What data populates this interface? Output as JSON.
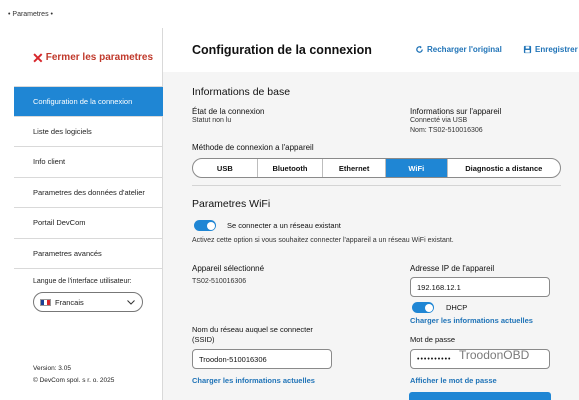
{
  "window": {
    "title": "• Parametres •"
  },
  "sidebar": {
    "close_label": "Fermer les parametres",
    "items": [
      {
        "label": "Configuration de la connexion",
        "active": true
      },
      {
        "label": "Liste des logiciels"
      },
      {
        "label": "Info client"
      },
      {
        "label": "Parametres des données d'atelier"
      },
      {
        "label": "Portail DevCom"
      },
      {
        "label": "Parametres avancés"
      }
    ],
    "language": {
      "label": "Langue de l'interface utilisateur:",
      "value": "Francais"
    },
    "version": "Version: 3.05",
    "copyright": "© DevCom spol. s r. o. 2025"
  },
  "header": {
    "title": "Configuration de la connexion",
    "reload_label": "Recharger l'original",
    "save_label": "Enregistrer"
  },
  "basic_info": {
    "title": "Informations de base",
    "connection_state_label": "État de la connexion",
    "connection_state_value": "Statut non lu",
    "device_info_label": "Informations sur l'appareil",
    "device_connected": "Connecté via USB",
    "device_name": "Nom: TS02-510016306"
  },
  "method": {
    "label": "Méthode de connexion a l'appareil",
    "options": [
      "USB",
      "Bluetooth",
      "Ethernet",
      "WiFi",
      "Diagnostic a distance"
    ],
    "selected": "WiFi"
  },
  "wifi": {
    "title": "Parametres WiFi",
    "connect_existing_label": "Se connecter a un réseau existant",
    "connect_existing_on": true,
    "description": "Activez cette option si vous souhaitez connecter l'appareil a un réseau WiFi existant.",
    "selected_device_label": "Appareil sélectionné",
    "selected_device_value": "TS02-510016306",
    "ip_label": "Adresse IP de l'appareil",
    "ip_value": "192.168.12.1",
    "dhcp_label": "DHCP",
    "dhcp_on": true,
    "load_current_ip": "Charger les informations actuelles",
    "ssid_label_line1": "Nom du réseau auquel se connecter",
    "ssid_label_line2": "(SSID)",
    "ssid_value": "Troodon-510016306",
    "load_current_ssid": "Charger les informations actuelles",
    "password_label": "Mot de passe",
    "password_value": "••••••••••",
    "password_overlay": "TroodonOBD",
    "show_password": "Afficher le mot de passe"
  },
  "colors": {
    "accent": "#1f86d4",
    "close_red": "#d7262b",
    "link": "#1f73b7"
  },
  "icons": {
    "close": "x-icon",
    "reload": "reload-icon",
    "save": "save-icon",
    "chevron": "chevron-down-icon",
    "flag": "french-flag-icon"
  }
}
